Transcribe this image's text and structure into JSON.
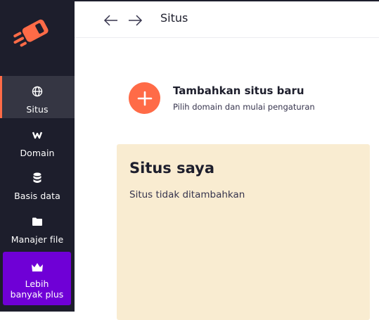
{
  "sidebar": {
    "items": [
      {
        "label": "Situs",
        "icon": "globe-icon",
        "active": true
      },
      {
        "label": "Domain",
        "icon": "www-icon",
        "active": false
      },
      {
        "label": "Basis data",
        "icon": "database-icon",
        "active": false
      },
      {
        "label": "Manajer file",
        "icon": "folder-icon",
        "active": false
      }
    ],
    "upgrade": {
      "label": "Lebih banyak plus",
      "icon": "crown-icon"
    }
  },
  "header": {
    "title": "Situs"
  },
  "add_site": {
    "title": "Tambahkan situs baru",
    "subtitle": "Pilih domain dan mulai pengaturan"
  },
  "my_sites": {
    "title": "Situs saya",
    "empty_text": "Situs tidak ditambahkan"
  },
  "colors": {
    "sidebar_bg": "#1d1e2c",
    "accent": "#ff6b47",
    "upgrade_bg": "#6f00d6",
    "card_bg": "#f9ecd1"
  }
}
